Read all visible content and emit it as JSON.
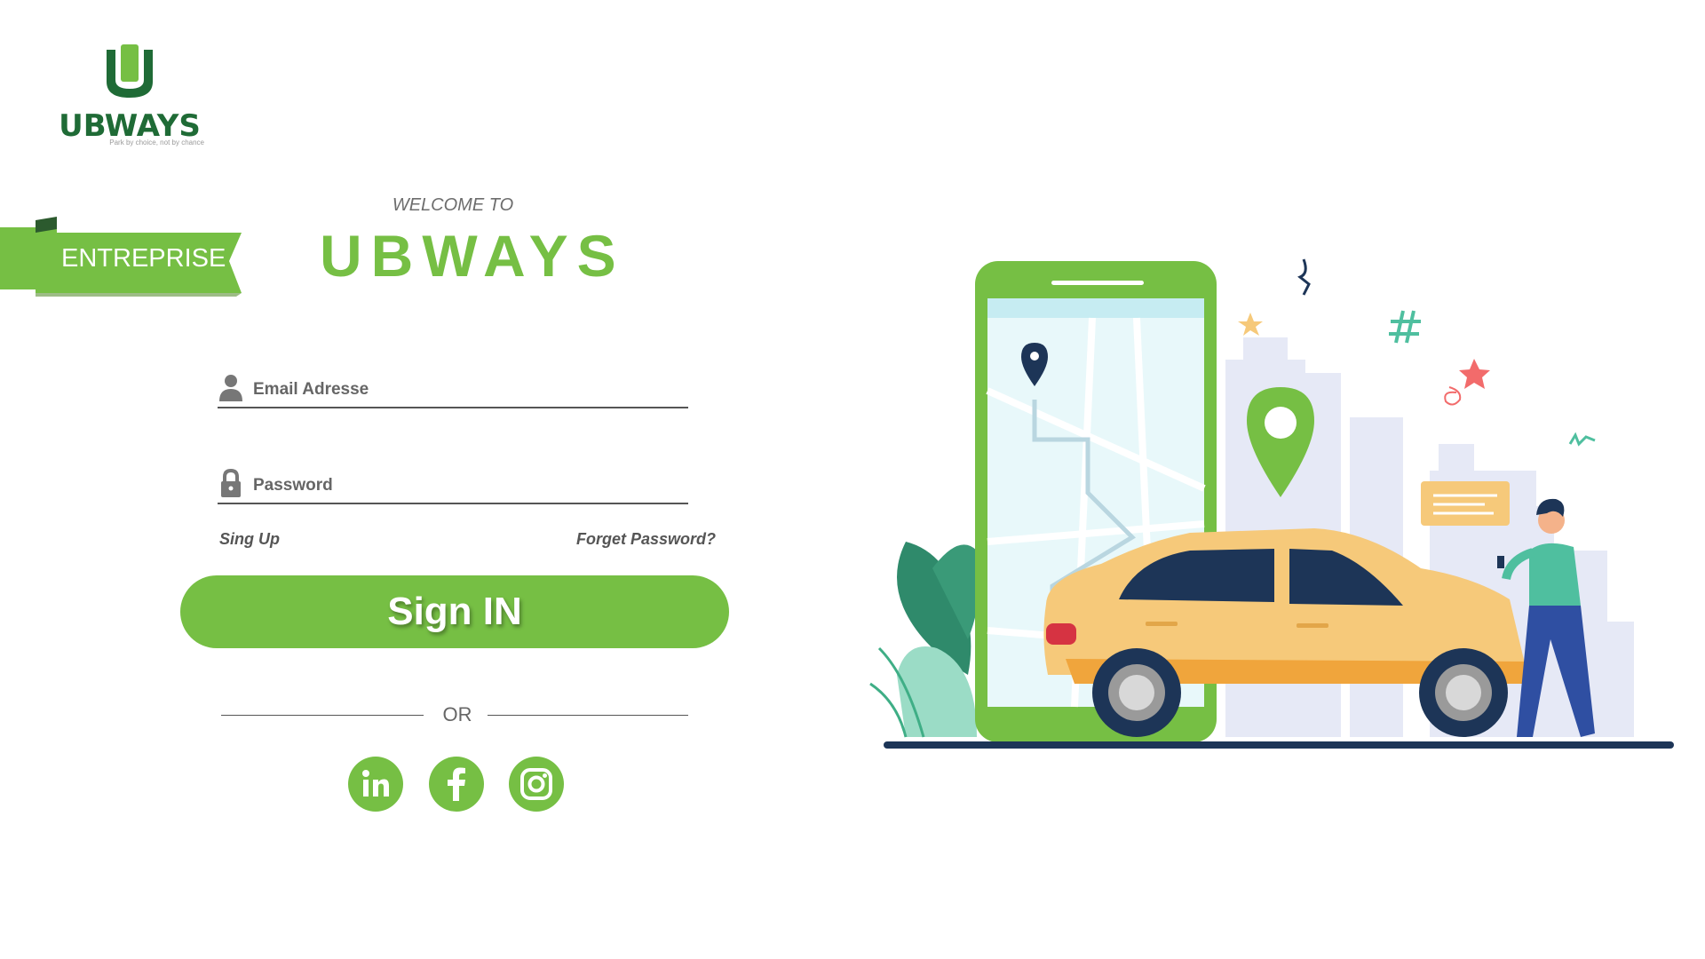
{
  "logo": {
    "brand": "UBWAYS",
    "tagline": "Park by choice, not by chance",
    "icon": "u-logo-icon"
  },
  "ribbon": {
    "label": "ENTREPRISE"
  },
  "welcome": {
    "small": "WELCOME TO",
    "big": "UBWAYS"
  },
  "form": {
    "email": {
      "label": "Email Adresse",
      "icon": "user-icon"
    },
    "password": {
      "label": "Password",
      "icon": "lock-icon"
    },
    "signup_link": "Sing Up",
    "forgot_link": "Forget Password?",
    "signin_button": "Sign IN",
    "or_text": "OR"
  },
  "social": [
    {
      "name": "LinkedIn",
      "icon": "linkedin-icon"
    },
    {
      "name": "Facebook",
      "icon": "facebook-icon"
    },
    {
      "name": "Instagram",
      "icon": "instagram-icon"
    }
  ],
  "colors": {
    "accent": "#76bf44",
    "dark_green": "#1f6b36",
    "text": "#555555",
    "car": "#f6c97a",
    "navy": "#1d3557"
  }
}
